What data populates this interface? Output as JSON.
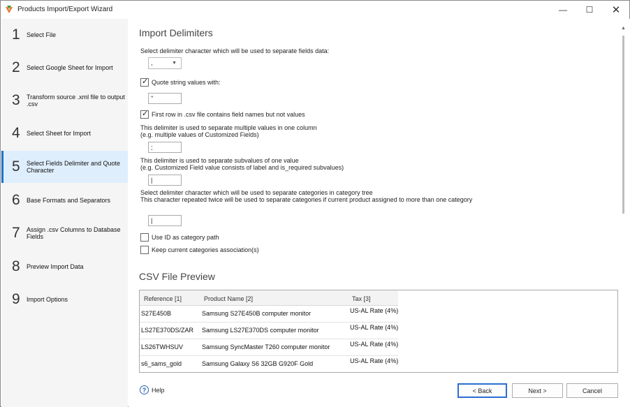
{
  "window": {
    "title": "Products Import/Export Wizard"
  },
  "window_controls": {
    "minimize": "—",
    "maximize": "☐",
    "close": "✕"
  },
  "steps": [
    {
      "num": "1",
      "label": "Select File"
    },
    {
      "num": "2",
      "label": "Select Google Sheet for Import"
    },
    {
      "num": "3",
      "label": "Transform source .xml file to output .csv"
    },
    {
      "num": "4",
      "label": "Select Sheet for Import"
    },
    {
      "num": "5",
      "label": "Select Fields Delimiter and Quote Character"
    },
    {
      "num": "6",
      "label": "Base Formats and Separators"
    },
    {
      "num": "7",
      "label": "Assign .csv Columns to Database Fields"
    },
    {
      "num": "8",
      "label": "Preview Import Data"
    },
    {
      "num": "9",
      "label": "Import Options"
    }
  ],
  "active_step": 5,
  "delimiters": {
    "heading": "Import Delimiters",
    "field_delim_label": "Select delimiter character which will be used to separate fields data:",
    "field_delim_value": ",",
    "quote_label": "Quote string values with:",
    "quote_checked": true,
    "quote_value": "\"",
    "first_row_label": "First row in .csv file contains field names but not values",
    "first_row_checked": true,
    "multi_value_label_1": "This delimiter is used to separate multiple values in one column",
    "multi_value_label_2": "(e.g. multiple values of Customized Fields)",
    "multi_value_value": ";",
    "subvalue_label_1": "This delimiter is used to separate subvalues of one value",
    "subvalue_label_2": "(e.g. Customized Field value consists of label and is_required subvalues)",
    "subvalue_value": "|",
    "category_label_1": "Select delimiter character which will be used to separate categories in category tree",
    "category_label_2": "This character repeated twice will be used to separate categories if current product assigned to more than one category",
    "category_value": "|",
    "use_id_label": "Use ID as category path",
    "use_id_checked": false,
    "keep_assoc_label": "Keep current categories association(s)",
    "keep_assoc_checked": false
  },
  "preview": {
    "heading": "CSV File Preview",
    "columns": [
      "Reference [1]",
      "Product Name [2]",
      "Tax [3]"
    ],
    "rows": [
      [
        "S27E450B",
        "Samsung S27E450B computer monitor",
        "US-AL Rate (4%)"
      ],
      [
        "LS27E370DS/ZAR",
        "Samsung LS27E370DS computer monitor",
        "US-AL Rate (4%)"
      ],
      [
        "LS26TWHSUV",
        "Samsung SyncMaster T260 computer monitor",
        "US-AL Rate (4%)"
      ],
      [
        "s6_sams_gold",
        "Samsung Galaxy S6 32GB G920F Gold",
        "US-AL Rate (4%)"
      ]
    ]
  },
  "footer": {
    "help_label": "Help",
    "back_label": "< Back",
    "next_label": "Next >",
    "cancel_label": "Cancel"
  },
  "colors": {
    "accent": "#1c6fc9",
    "active_step_bg": "#dfeefc",
    "sidebar_bg": "#f5f5f5"
  }
}
